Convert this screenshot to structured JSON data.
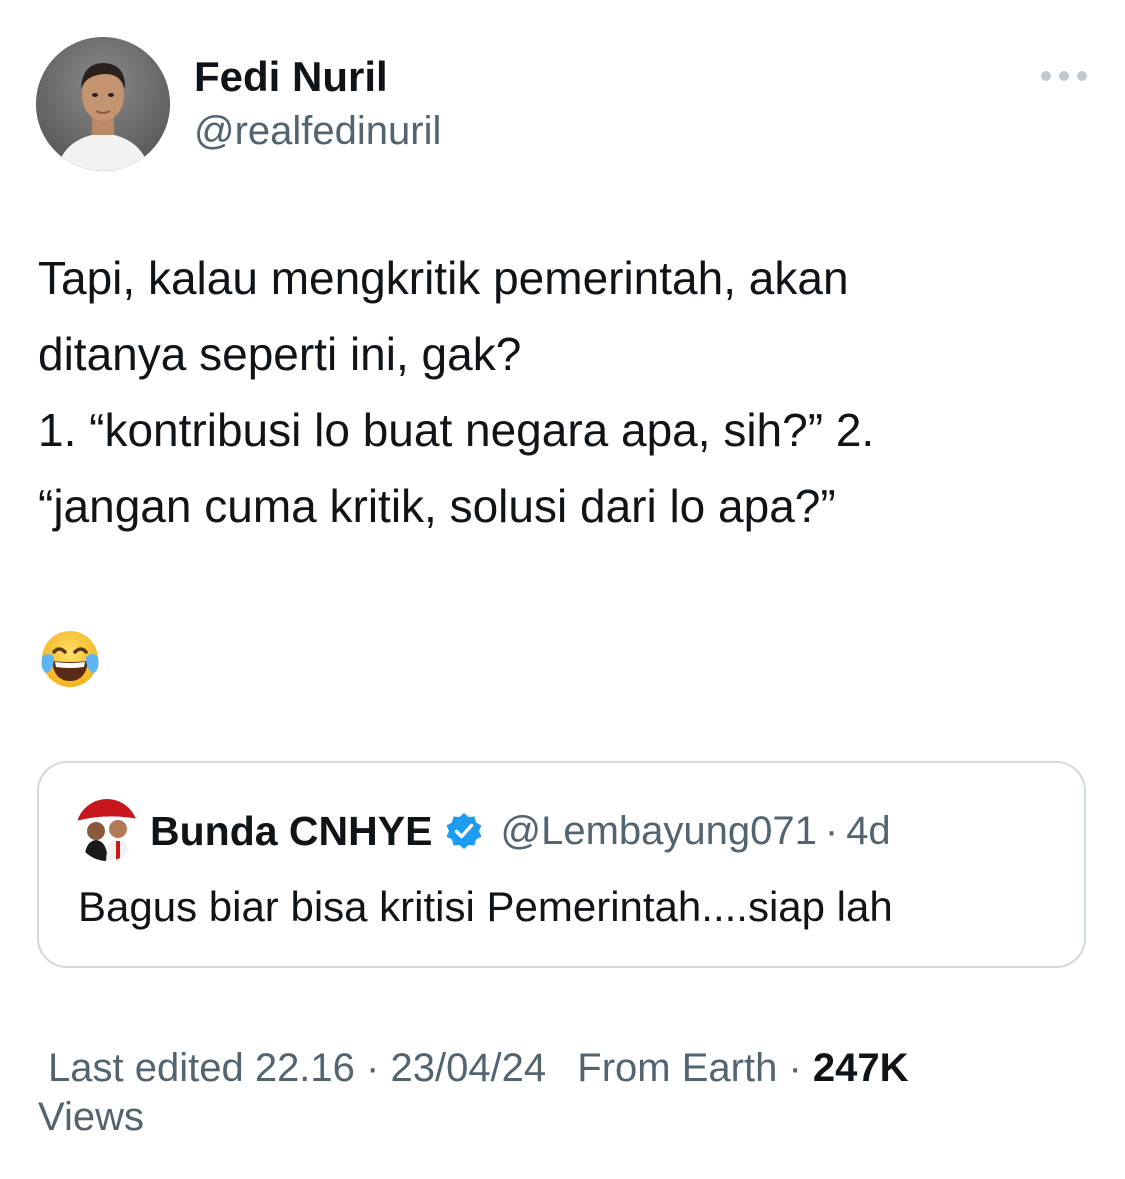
{
  "author": {
    "display_name": "Fedi Nuril",
    "handle": "@realfedinuril",
    "avatar_icon": "profile-photo"
  },
  "more_menu": {
    "icon": "more-horizontal-icon"
  },
  "tweet": {
    "lines": [
      "Tapi, kalau mengkritik pemerintah, akan",
      "ditanya seperti ini, gak?",
      "1. “kontribusi lo buat negara apa, sih?”  2.",
      "“jangan cuma kritik, solusi dari lo apa?”"
    ],
    "emoji": "😂",
    "emoji_icon": "face-with-tears-of-joy"
  },
  "quoted_tweet": {
    "display_name": "Bunda CNHYE",
    "verified_icon": "verified-badge",
    "handle": "@Lembayung071",
    "separator": "·",
    "age": "4d",
    "text": "Bagus biar bisa kritisi Pemerintah....siap lah"
  },
  "footer": {
    "edited": "Last edited 22.16 · 23/04/24",
    "source": "From Earth ·",
    "views_count": "247K",
    "views_label": "Views"
  },
  "colors": {
    "primary_text": "#0f1419",
    "secondary_text": "#536471",
    "border": "#cfd9de",
    "verified_blue": "#1d9bf0"
  }
}
